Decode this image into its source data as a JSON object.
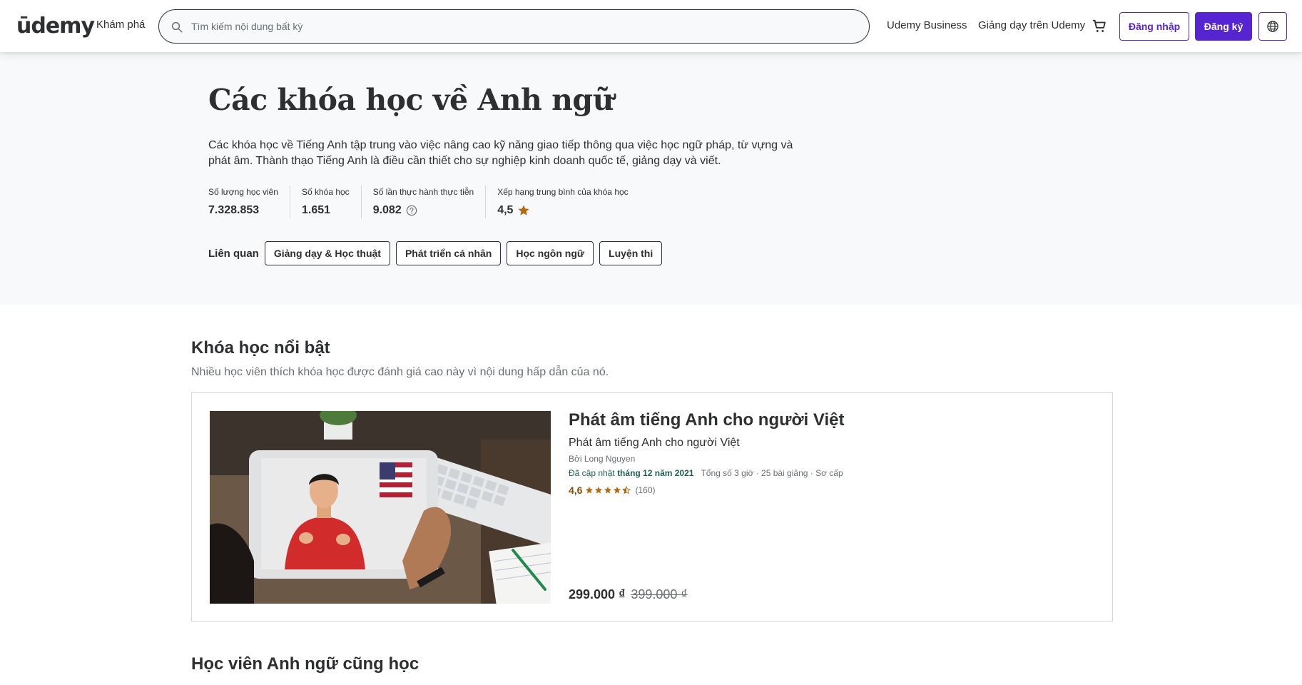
{
  "header": {
    "logo": "ūdemy",
    "explore": "Khám phá",
    "search_placeholder": "Tìm kiếm nội dung bất kỳ",
    "business": "Udemy Business",
    "teach": "Giảng dạy trên Udemy",
    "login": "Đăng nhập",
    "signup": "Đăng ký",
    "icons": [
      "search-icon",
      "cart-icon",
      "globe-icon"
    ]
  },
  "hero": {
    "title": "Các khóa học về Anh ngữ",
    "description": "Các khóa học về Tiếng Anh tập trung vào việc nâng cao kỹ năng giao tiếp thông qua việc học ngữ pháp, từ vựng và phát âm. Thành thạo Tiếng Anh là điều cần thiết cho sự nghiệp kinh doanh quốc tế, giảng dạy và viết.",
    "stats": [
      {
        "label": "Số lượng học viên",
        "value": "7.328.853"
      },
      {
        "label": "Số khóa học",
        "value": "1.651"
      },
      {
        "label": "Số lần thực hành thực tiễn",
        "value": "9.082"
      },
      {
        "label": "Xếp hạng trung bình của khóa học",
        "value": "4,5"
      }
    ],
    "related_label": "Liên quan",
    "related": [
      "Giảng dạy & Học thuật",
      "Phát triển cá nhân",
      "Học ngôn ngữ",
      "Luyện thi"
    ]
  },
  "featured": {
    "title": "Khóa học nổi bật",
    "subtitle": "Nhiều học viên thích khóa học được đánh giá cao này vì nội dung hấp dẫn của nó.",
    "course": {
      "title": "Phát âm tiếng Anh cho người Việt",
      "subtitle": "Phát âm tiếng Anh cho người Việt",
      "author": "Bởi Long Nguyen",
      "updated_prefix": "Đã cập nhật",
      "updated_date": "tháng 12 năm 2021",
      "details": "Tổng số 3 giờ · 25 bài giảng · Sơ cấp",
      "rating": "4,6",
      "rating_stars": 4.5,
      "rating_count": "(160)",
      "price": "299.000 ₫",
      "original_price": "399.000 ₫"
    }
  },
  "also_learn": {
    "title": "Học viên Anh ngữ cũng học"
  },
  "colors": {
    "brand": "#5624d0",
    "star": "#b4690e",
    "rating_text": "#8a4d0a",
    "updated": "#1e6055"
  }
}
